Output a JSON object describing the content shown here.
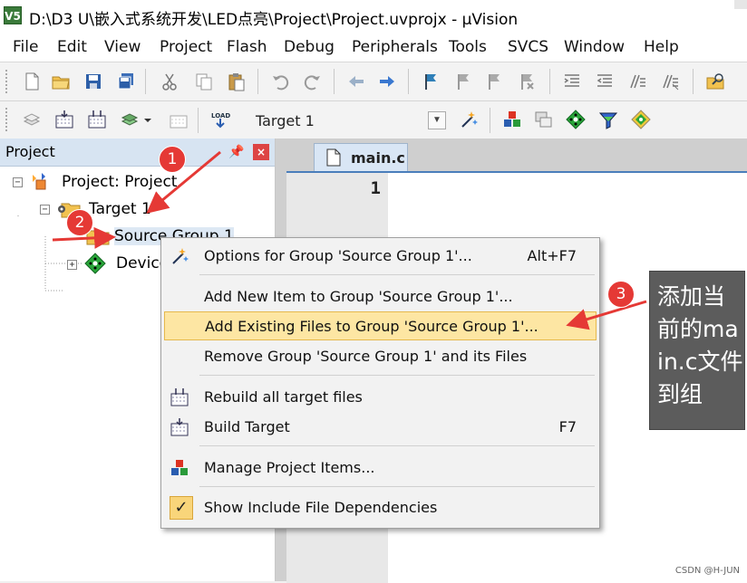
{
  "window": {
    "app_icon_text": "V5",
    "title": "D:\\D3 U\\嵌入式系统开发\\LED点亮\\Project\\Project.uvprojx - µVision"
  },
  "menubar": [
    "File",
    "Edit",
    "View",
    "Project",
    "Flash",
    "Debug",
    "Peripherals",
    "Tools",
    "SVCS",
    "Window",
    "Help"
  ],
  "toolbar2": {
    "load_label": "LOAD",
    "target_select": "Target 1"
  },
  "project_panel": {
    "title": "Project",
    "tree": {
      "root": "Project: Project",
      "target": "Target 1",
      "group": "Source Group 1",
      "device": "Device"
    }
  },
  "editor": {
    "tab": "main.c",
    "line_number": "1"
  },
  "context_menu": {
    "items": [
      {
        "label": "Options for Group 'Source Group 1'...",
        "shortcut": "Alt+F7",
        "icon": "options-wand-icon"
      },
      {
        "label": "Add New  Item to Group 'Source Group 1'...",
        "shortcut": "",
        "icon": ""
      },
      {
        "label": "Add Existing Files to Group 'Source Group 1'...",
        "shortcut": "",
        "icon": "",
        "highlighted": true
      },
      {
        "label": "Remove Group 'Source Group 1' and its Files",
        "shortcut": "",
        "icon": ""
      },
      {
        "label": "Rebuild all target files",
        "shortcut": "",
        "icon": "rebuild-icon"
      },
      {
        "label": "Build Target",
        "shortcut": "F7",
        "icon": "build-icon"
      },
      {
        "label": "Manage Project Items...",
        "shortcut": "",
        "icon": "manage-items-icon"
      },
      {
        "label": "Show Include File Dependencies",
        "shortcut": "",
        "icon": "checkmark-icon",
        "checked": true
      }
    ]
  },
  "annotations": {
    "badges": [
      "1",
      "2",
      "3"
    ],
    "note": "添加当前的main.c文件到组"
  },
  "watermark": "CSDN @H-JUN",
  "colors": {
    "highlight": "#fde6a3",
    "badge": "#e53935",
    "arrow": "#e53935",
    "panel_header": "#d7e4f2",
    "annotation_bg": "#5c5c5c"
  }
}
